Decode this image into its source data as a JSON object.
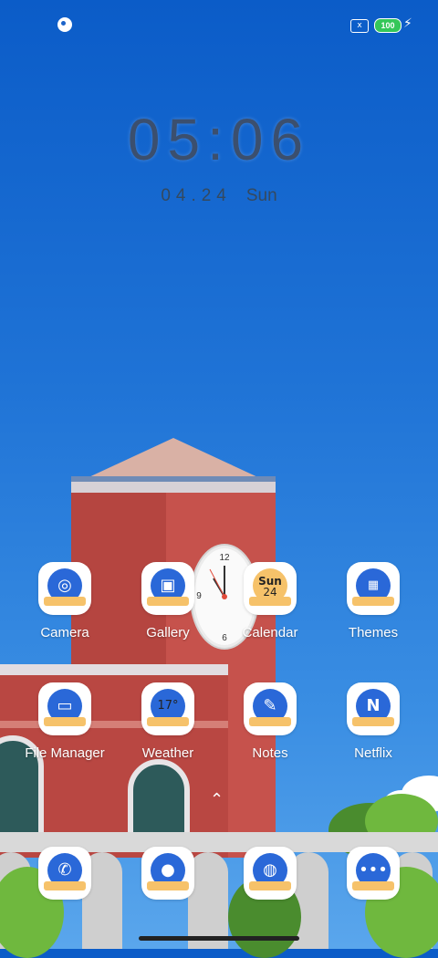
{
  "status": {
    "battery": "100",
    "sim_label": "x"
  },
  "lockclock": {
    "time": "05:06",
    "date": "04.24",
    "weekday": "Sun"
  },
  "apps_row1": [
    {
      "label": "Camera",
      "icon": "camera-icon"
    },
    {
      "label": "Gallery",
      "icon": "gallery-icon"
    },
    {
      "label": "Calendar",
      "icon": "calendar-icon",
      "day": "Sun",
      "date": "24"
    },
    {
      "label": "Themes",
      "icon": "themes-icon"
    }
  ],
  "apps_row2": [
    {
      "label": "File Manager",
      "icon": "file-manager-icon"
    },
    {
      "label": "Weather",
      "icon": "weather-icon",
      "temp": "17°"
    },
    {
      "label": "Notes",
      "icon": "notes-icon"
    },
    {
      "label": "Netflix",
      "icon": "netflix-icon",
      "glyph": "N"
    }
  ],
  "dock": [
    {
      "icon": "phone-icon"
    },
    {
      "icon": "contacts-icon"
    },
    {
      "icon": "browser-icon"
    },
    {
      "icon": "messages-icon"
    }
  ],
  "colors": {
    "accent": "#2a68d8",
    "ribbon": "#f6c26a"
  }
}
